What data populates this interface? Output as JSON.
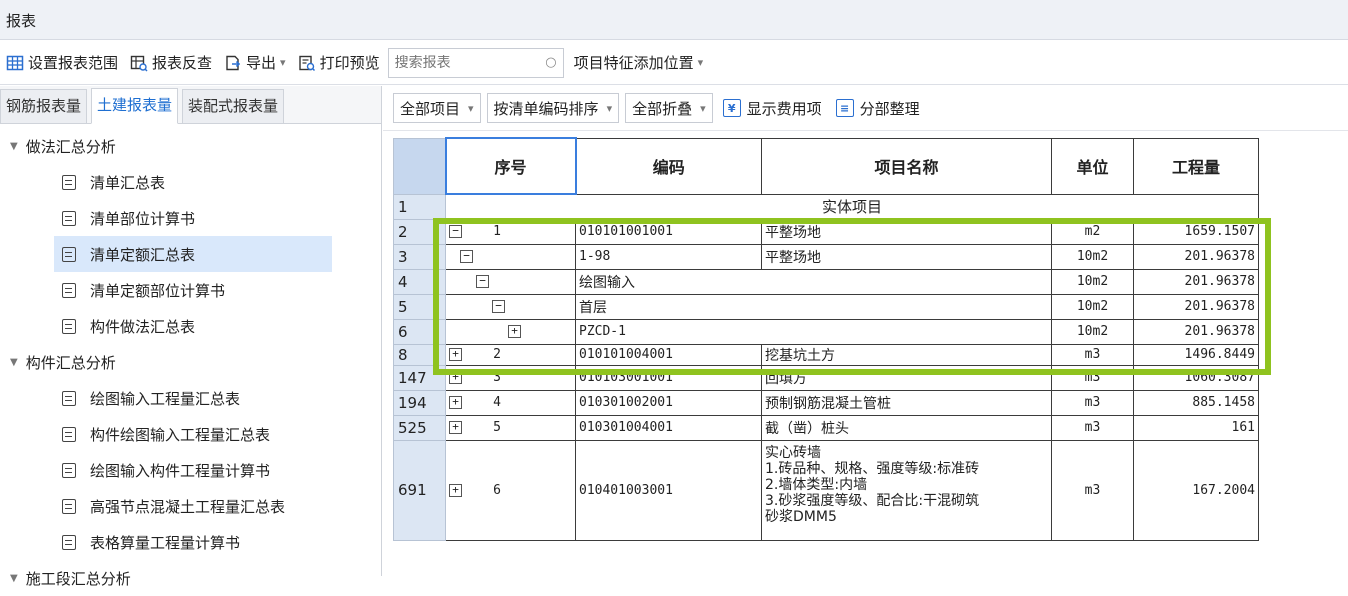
{
  "window": {
    "title": "报表"
  },
  "toolbar": {
    "set_range": "设置报表范围",
    "reverse_check": "报表反查",
    "export": "导出",
    "print_preview": "打印预览",
    "search_placeholder": "搜索报表",
    "feature_position": "项目特征添加位置"
  },
  "tabs": [
    {
      "label": "钢筋报表量"
    },
    {
      "label": "土建报表量"
    },
    {
      "label": "装配式报表量"
    }
  ],
  "tree": {
    "group1": "做法汇总分析",
    "group1_items": [
      "清单汇总表",
      "清单部位计算书",
      "清单定额汇总表",
      "清单定额部位计算书",
      "构件做法汇总表"
    ],
    "group2": "构件汇总分析",
    "group2_items": [
      "绘图输入工程量汇总表",
      "构件绘图输入工程量汇总表",
      "绘图输入构件工程量计算书",
      "高强节点混凝土工程量汇总表",
      "表格算量工程量计算书"
    ],
    "group3": "施工段汇总分析"
  },
  "report_toolbar": {
    "all_items": "全部项目",
    "sort_by_code": "按清单编码排序",
    "collapse_all": "全部折叠",
    "show_fee": "显示费用项",
    "reorganize": "分部整理"
  },
  "table": {
    "headers": {
      "seq": "序号",
      "code": "编码",
      "name": "项目名称",
      "unit": "单位",
      "qty": "工程量"
    },
    "section_title": "实体项目",
    "rows": [
      {
        "rn": "2",
        "seq": "1",
        "code": "010101001001",
        "name": "平整场地",
        "unit": "m2",
        "qty": "1659.1507"
      },
      {
        "rn": "3",
        "code": "1-98",
        "name": "平整场地",
        "unit": "10m2",
        "qty": "201.96378"
      },
      {
        "rn": "4",
        "name": "绘图输入",
        "unit": "10m2",
        "qty": "201.96378"
      },
      {
        "rn": "5",
        "name": "首层",
        "unit": "10m2",
        "qty": "201.96378"
      },
      {
        "rn": "6",
        "name": "PZCD-1",
        "unit": "10m2",
        "qty": "201.96378"
      },
      {
        "rn": "8",
        "seq": "2",
        "code": "010101004001",
        "name": "挖基坑土方",
        "unit": "m3",
        "qty": "1496.8449"
      },
      {
        "rn": "147",
        "seq": "3",
        "code": "010103001001",
        "name": "回填方",
        "unit": "m3",
        "qty": "1060.3087"
      },
      {
        "rn": "194",
        "seq": "4",
        "code": "010301002001",
        "name": "预制钢筋混凝土管桩",
        "unit": "m3",
        "qty": "885.1458"
      },
      {
        "rn": "525",
        "seq": "5",
        "code": "010301004001",
        "name": "截（凿）桩头",
        "unit": "m3",
        "qty": "161"
      },
      {
        "rn": "691",
        "seq": "6",
        "code": "010401003001",
        "name_lines": [
          "实心砖墙",
          "1.砖品种、规格、强度等级:标准砖",
          "2.墙体类型:内墙",
          "3.砂浆强度等级、配合比:干混砌筑",
          "砂浆DMM5"
        ],
        "unit": "m3",
        "qty": "167.2004"
      }
    ],
    "row1": "1"
  },
  "colors": {
    "highlight": "#8fc31f",
    "active_tab": "#1f6fd1",
    "row_header": "#dce6f3"
  }
}
